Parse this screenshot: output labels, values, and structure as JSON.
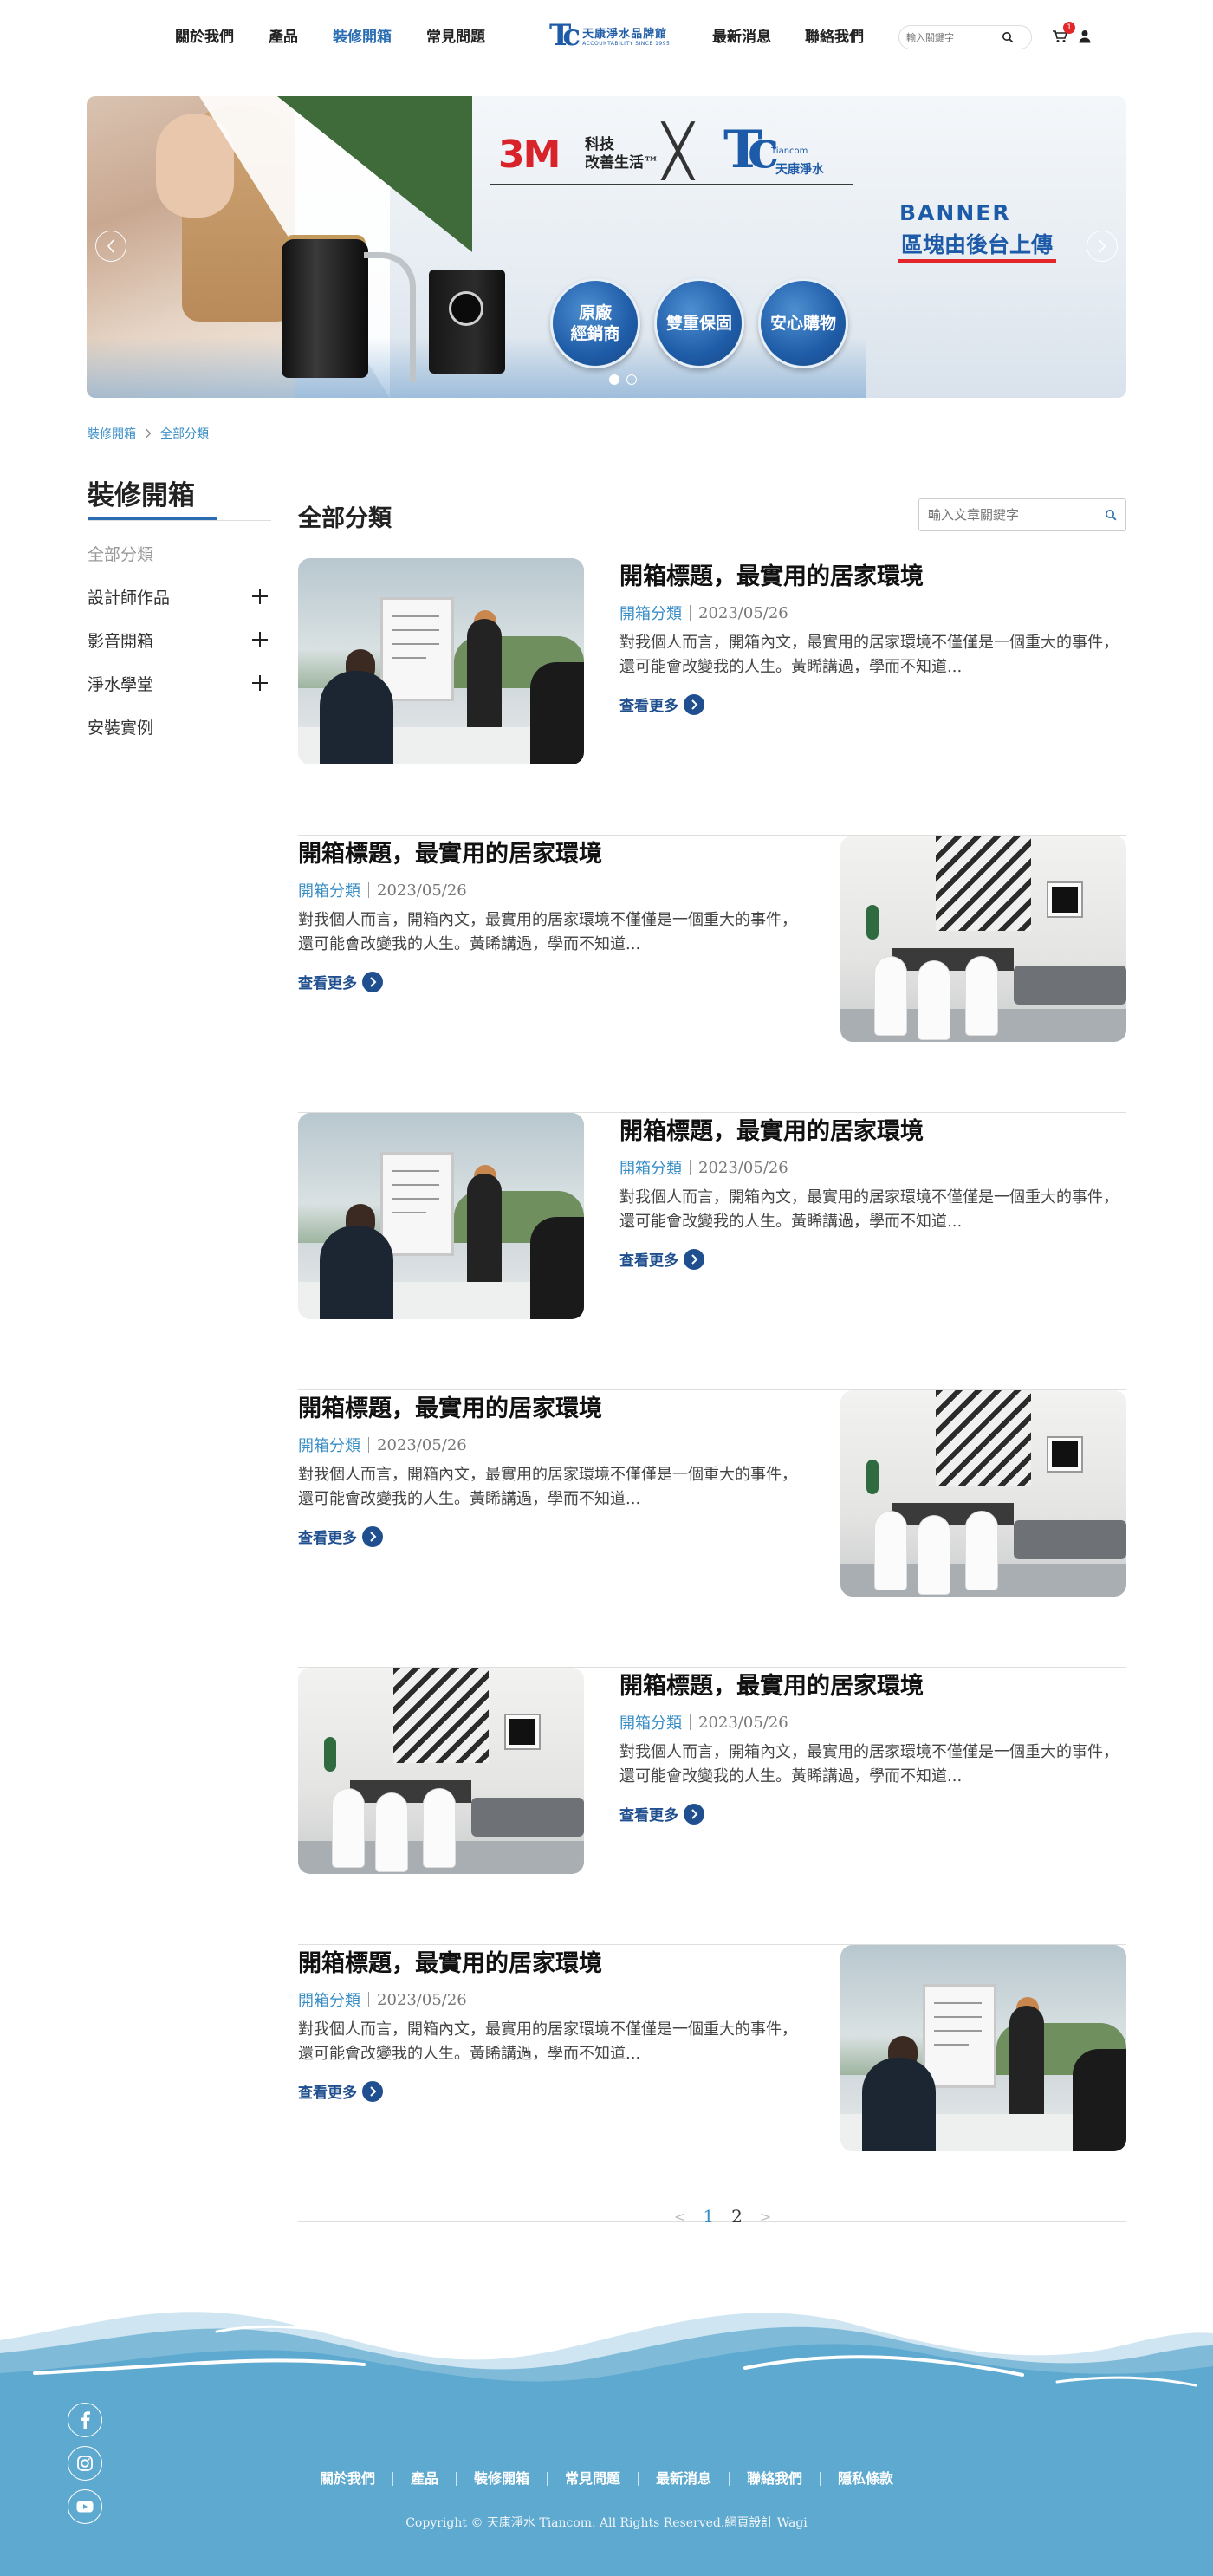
{
  "header": {
    "nav_left": [
      "關於我們",
      "產品",
      "裝修開箱",
      "常見問題"
    ],
    "nav_right": [
      "最新消息",
      "聯絡我們"
    ],
    "active_index": 2,
    "logo": {
      "mark": "Tc",
      "cn": "天康淨水品牌館",
      "en": "ACCOUNTABILITY SINCE 1995"
    },
    "search_placeholder": "輸入關鍵字",
    "cart_count": "1"
  },
  "banner": {
    "brand_3m": "3M",
    "brand_3m_cn_line1": "科技",
    "brand_3m_cn_line2": "改善生活™",
    "x_mark": "╳",
    "brand_tc": "Tc",
    "brand_tc_en": "Tiancom",
    "brand_tc_cn": "天康淨水",
    "badges": [
      "原廠\n經銷商",
      "雙重保固",
      "安心購物"
    ],
    "caption_en": "BANNER",
    "caption_cn": "區塊由後台上傳",
    "slide_count": 2,
    "current_slide": 1
  },
  "breadcrumb": [
    "裝修開箱",
    "全部分類"
  ],
  "sidebar": {
    "title": "裝修開箱",
    "items": [
      {
        "label": "全部分類",
        "expandable": false
      },
      {
        "label": "設計師作品",
        "expandable": true
      },
      {
        "label": "影音開箱",
        "expandable": true
      },
      {
        "label": "淨水學堂",
        "expandable": true
      },
      {
        "label": "安裝實例",
        "expandable": false
      }
    ]
  },
  "main": {
    "title": "全部分類",
    "search_placeholder": "輸入文章關鍵字",
    "read_more": "查看更多",
    "articles": [
      {
        "title": "開箱標題，最實用的居家環境",
        "category": "開箱分類",
        "date": "2023/05/26",
        "excerpt": "對我個人而言，開箱內文，最實用的居家環境不僅僅是一個重大的事件，還可能會改變我的人生。黃睎講過，學而不知道...",
        "image": "meeting",
        "image_side": "left"
      },
      {
        "title": "開箱標題，最實用的居家環境",
        "category": "開箱分類",
        "date": "2023/05/26",
        "excerpt": "對我個人而言，開箱內文，最實用的居家環境不僅僅是一個重大的事件，還可能會改變我的人生。黃睎講過，學而不知道...",
        "image": "dining",
        "image_side": "right"
      },
      {
        "title": "開箱標題，最實用的居家環境",
        "category": "開箱分類",
        "date": "2023/05/26",
        "excerpt": "對我個人而言，開箱內文，最實用的居家環境不僅僅是一個重大的事件，還可能會改變我的人生。黃睎講過，學而不知道...",
        "image": "meeting",
        "image_side": "left"
      },
      {
        "title": "開箱標題，最實用的居家環境",
        "category": "開箱分類",
        "date": "2023/05/26",
        "excerpt": "對我個人而言，開箱內文，最實用的居家環境不僅僅是一個重大的事件，還可能會改變我的人生。黃睎講過，學而不知道...",
        "image": "dining",
        "image_side": "right"
      },
      {
        "title": "開箱標題，最實用的居家環境",
        "category": "開箱分類",
        "date": "2023/05/26",
        "excerpt": "對我個人而言，開箱內文，最實用的居家環境不僅僅是一個重大的事件，還可能會改變我的人生。黃睎講過，學而不知道...",
        "image": "dining",
        "image_side": "left"
      },
      {
        "title": "開箱標題，最實用的居家環境",
        "category": "開箱分類",
        "date": "2023/05/26",
        "excerpt": "對我個人而言，開箱內文，最實用的居家環境不僅僅是一個重大的事件，還可能會改變我的人生。黃睎講過，學而不知道...",
        "image": "meeting",
        "image_side": "right"
      }
    ]
  },
  "pagination": {
    "prev": "<",
    "pages": [
      "1",
      "2"
    ],
    "current": "1",
    "next": ">"
  },
  "footer": {
    "social": [
      "facebook-icon",
      "instagram-icon",
      "youtube-icon"
    ],
    "links": [
      "關於我們",
      "產品",
      "裝修開箱",
      "常見問題",
      "最新消息",
      "聯絡我們",
      "隱私條款"
    ],
    "copyright": "Copyright © 天康淨水 Tiancom. All Rights Reserved.網頁設計 Wagi"
  },
  "colors": {
    "accent": "#2a6db2",
    "link_blue": "#3a8ec6",
    "read_more": "#1f4f8f",
    "footer_wave": "#5ea9cf",
    "badge_red": "#e3262a"
  }
}
